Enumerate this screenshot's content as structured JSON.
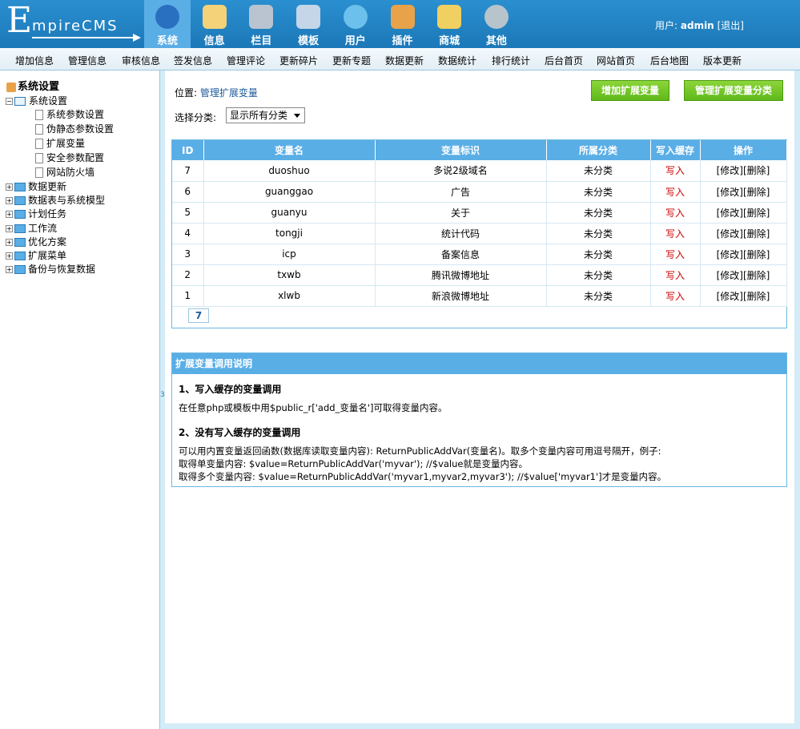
{
  "logo": {
    "big": "E",
    "rest": "mpireCMS"
  },
  "topnav": [
    {
      "label": "系统",
      "icon": "globe-icon",
      "color": "#2a70c0",
      "active": true
    },
    {
      "label": "信息",
      "icon": "notepad-icon",
      "color": "#f3d27a"
    },
    {
      "label": "栏目",
      "icon": "folder-icon",
      "color": "#b9c4d0"
    },
    {
      "label": "模板",
      "icon": "window-icon",
      "color": "#c4d6e8"
    },
    {
      "label": "用户",
      "icon": "user-icon",
      "color": "#6cc0ec"
    },
    {
      "label": "插件",
      "icon": "tools-icon",
      "color": "#e8a24a"
    },
    {
      "label": "商城",
      "icon": "card-icon",
      "color": "#f0d060"
    },
    {
      "label": "其他",
      "icon": "gear-icon",
      "color": "#b8c4cc"
    }
  ],
  "user": {
    "prefix": "用户:",
    "name": "admin",
    "logout": "[退出]"
  },
  "subnav": [
    "增加信息",
    "管理信息",
    "审核信息",
    "签发信息",
    "管理评论",
    "更新碎片",
    "更新专题",
    "数据更新",
    "数据统计",
    "排行统计",
    "后台首页",
    "网站首页",
    "后台地图",
    "版本更新"
  ],
  "sidebar": {
    "root": "系统设置",
    "group": "系统设置",
    "children": [
      "系统参数设置",
      "伪静态参数设置",
      "扩展变量",
      "安全参数配置",
      "网站防火墙"
    ],
    "others": [
      "数据更新",
      "数据表与系统模型",
      "计划任务",
      "工作流",
      "优化方案",
      "扩展菜单",
      "备份与恢复数据"
    ]
  },
  "gutter_char": "3",
  "main": {
    "location_prefix": "位置:",
    "location_link": "管理扩展变量",
    "btn_add": "增加扩展变量",
    "btn_manage": "管理扩展变量分类",
    "cat_label": "选择分类:",
    "cat_value": "显示所有分类"
  },
  "table": {
    "headers": [
      "ID",
      "变量名",
      "变量标识",
      "所属分类",
      "写入缓存",
      "操作"
    ],
    "rows": [
      {
        "id": "7",
        "name": "duoshuo",
        "label": "多说2级域名",
        "cat": "未分类",
        "cache": "写入",
        "edit": "[修改]",
        "del": "[删除]"
      },
      {
        "id": "6",
        "name": "guanggao",
        "label": "广告",
        "cat": "未分类",
        "cache": "写入",
        "edit": "[修改]",
        "del": "[删除]"
      },
      {
        "id": "5",
        "name": "guanyu",
        "label": "关于",
        "cat": "未分类",
        "cache": "写入",
        "edit": "[修改]",
        "del": "[删除]"
      },
      {
        "id": "4",
        "name": "tongji",
        "label": "统计代码",
        "cat": "未分类",
        "cache": "写入",
        "edit": "[修改]",
        "del": "[删除]"
      },
      {
        "id": "3",
        "name": "icp",
        "label": "备案信息",
        "cat": "未分类",
        "cache": "写入",
        "edit": "[修改]",
        "del": "[删除]"
      },
      {
        "id": "2",
        "name": "txwb",
        "label": "腾讯微博地址",
        "cat": "未分类",
        "cache": "写入",
        "edit": "[修改]",
        "del": "[删除]"
      },
      {
        "id": "1",
        "name": "xlwb",
        "label": "新浪微博地址",
        "cat": "未分类",
        "cache": "写入",
        "edit": "[修改]",
        "del": "[删除]"
      }
    ],
    "pager": "7"
  },
  "notes": {
    "title": "扩展变量调用说明",
    "h1": "1、写入缓存的变量调用",
    "t1": "在任意php或模板中用$public_r['add_变量名']可取得变量内容。",
    "h2": "2、没有写入缓存的变量调用",
    "t2a": "可以用内置变量返回函数(数据库读取变量内容): ReturnPublicAddVar(变量名)。取多个变量内容可用逗号隔开，例子:",
    "t2b": "取得单变量内容: $value=ReturnPublicAddVar('myvar'); //$value就是变量内容。",
    "t2c": "取得多个变量内容: $value=ReturnPublicAddVar('myvar1,myvar2,myvar3'); //$value['myvar1']才是变量内容。"
  }
}
